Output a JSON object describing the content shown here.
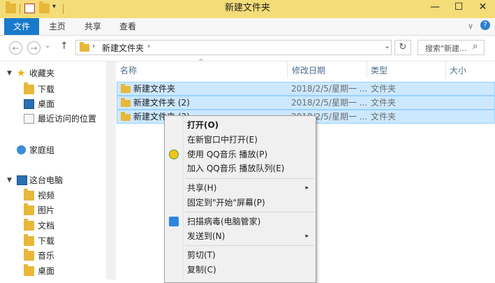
{
  "window": {
    "title": "新建文件夹",
    "minimize": "—",
    "maximize": "☐",
    "close": "✕"
  },
  "quick_access": {
    "dropdown": "▾"
  },
  "ribbon": {
    "file_tab": "文件",
    "tabs": [
      "主页",
      "共享",
      "查看"
    ],
    "help": "?",
    "collapse": "∨"
  },
  "address": {
    "back": "←",
    "forward": "→",
    "history": "⌄",
    "up": "↑",
    "path": [
      "新建文件夹"
    ],
    "path_sep": "›",
    "dropdown": "⌄",
    "refresh": "↻",
    "search_placeholder": "搜索\"新建...",
    "search_icon": "⌕"
  },
  "nav_pane": {
    "favorites": {
      "label": "收藏夹",
      "items": [
        "下载",
        "桌面",
        "最近访问的位置"
      ]
    },
    "homegroup": {
      "label": "家庭组"
    },
    "this_pc": {
      "label": "这台电脑",
      "items": [
        "视频",
        "图片",
        "文档",
        "下载",
        "音乐",
        "桌面"
      ]
    }
  },
  "columns": {
    "name": "名称",
    "date": "修改日期",
    "type": "类型",
    "size": "大小",
    "sort_indicator": "^"
  },
  "files": [
    {
      "name": "新建文件夹",
      "date": "2018/2/5/星期一 ...",
      "type": "文件夹"
    },
    {
      "name": "新建文件夹 (2)",
      "date": "2018/2/5/星期一 ...",
      "type": "文件夹"
    },
    {
      "name": "新建文件夹 (3)",
      "date": "2018/2/5/星期一 ...",
      "type": "文件夹"
    }
  ],
  "context_menu": {
    "open": "打开(O)",
    "open_new_window": "在新窗口中打开(E)",
    "qq_play": "使用 QQ音乐 播放(P)",
    "qq_queue": "加入 QQ音乐 播放队列(E)",
    "share": "共享(H)",
    "pin_start": "固定到\"开始\"屏幕(P)",
    "scan": "扫描病毒(电脑管家)",
    "send_to": "发送到(N)",
    "cut": "剪切(T)",
    "copy": "复制(C)",
    "submenu_arrow": "▸"
  },
  "colors": {
    "accent": "#1979ca",
    "title_bar": "#f4dc78",
    "selection": "#cce8ff",
    "folder": "#e9b739"
  }
}
